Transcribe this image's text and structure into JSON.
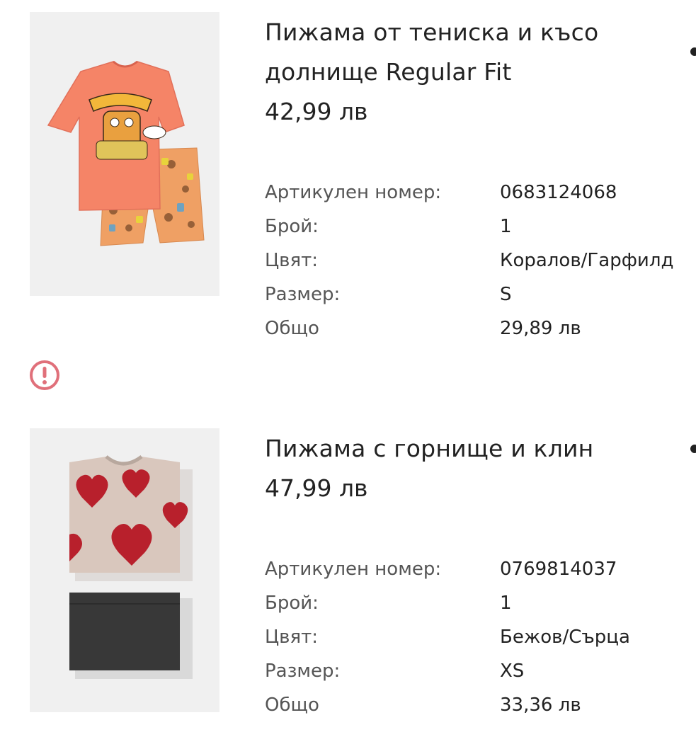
{
  "products": [
    {
      "title": "Пижама от тениска и късо долнище Regular Fit",
      "price": "42,99 лв",
      "image_icon": "coral-tshirt-shorts-pajama-image",
      "details": [
        {
          "label": "Артикулен номер:",
          "value": "0683124068"
        },
        {
          "label": "Брой:",
          "value": "1"
        },
        {
          "label": "Цвят:",
          "value": "Коралов/Гарфилд"
        },
        {
          "label": "Размер:",
          "value": "S"
        },
        {
          "label": "Общо",
          "value": "29,89 лв"
        }
      ]
    },
    {
      "title": "Пижама с горнище и клин",
      "price": "47,99 лв",
      "image_icon": "beige-hearts-top-leggings-pajama-image",
      "details": [
        {
          "label": "Артикулен номер:",
          "value": "0769814037"
        },
        {
          "label": "Брой:",
          "value": "1"
        },
        {
          "label": "Цвят:",
          "value": "Бежов/Сърца"
        },
        {
          "label": "Размер:",
          "value": "XS"
        },
        {
          "label": "Общо",
          "value": "33,36 лв"
        }
      ]
    }
  ],
  "warning": {
    "icon": "alert-circle-icon",
    "color": "#e0707a"
  },
  "colors": {
    "coral": "#f58467",
    "heart_red": "#b8202c",
    "beige": "#d9c7bd",
    "charcoal": "#383838",
    "image_bg": "#f0f0f0"
  }
}
